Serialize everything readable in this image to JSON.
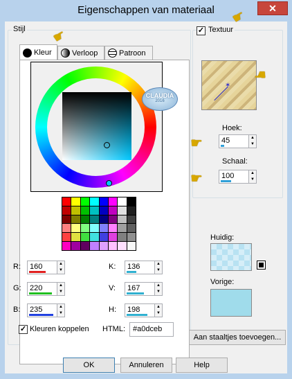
{
  "window": {
    "title": "Eigenschappen van materiaal",
    "close_glyph": "✕"
  },
  "style_group": {
    "label": "Stijl"
  },
  "tabs": [
    {
      "label": "Kleur",
      "icon": "filled-circle-icon"
    },
    {
      "label": "Verloop",
      "icon": "gradient-circle-icon"
    },
    {
      "label": "Patroon",
      "icon": "globe-icon"
    }
  ],
  "color_inputs": [
    {
      "key": "R",
      "label": "R:",
      "value": "160",
      "bar_color": "#e02020",
      "fraction": 0.63
    },
    {
      "key": "G",
      "label": "G:",
      "value": "220",
      "bar_color": "#20c020",
      "fraction": 0.86
    },
    {
      "key": "B",
      "label": "B:",
      "value": "235",
      "bar_color": "#2040e0",
      "fraction": 0.92
    },
    {
      "key": "K",
      "label": "K:",
      "value": "136",
      "bar_color": "#30b0d0",
      "fraction": 0.38
    },
    {
      "key": "V",
      "label": "V:",
      "value": "167",
      "bar_color": "#30b0d0",
      "fraction": 0.65
    },
    {
      "key": "H",
      "label": "H:",
      "value": "198",
      "bar_color": "#30b0d0",
      "fraction": 0.78
    }
  ],
  "link_colors": {
    "label": "Kleuren koppelen",
    "checked": true
  },
  "html_field": {
    "label": "HTML:",
    "value": "#a0dceb"
  },
  "texture": {
    "label": "Textuur",
    "checked": true,
    "angle_label": "Hoek:",
    "angle_value": "45",
    "angle_fraction": 0.12,
    "scale_label": "Schaal:",
    "scale_value": "100",
    "scale_fraction": 0.4
  },
  "current": {
    "label": "Huidig:"
  },
  "previous": {
    "label": "Vorige:"
  },
  "add_swatches_button": "Aan staaltjes toevoegen...",
  "buttons": {
    "ok": "OK",
    "cancel": "Annuleren",
    "help": "Help"
  },
  "watermark": {
    "text": "CLAUDIA",
    "subtext": "2016"
  },
  "colors": {
    "selected": "#a0dceb",
    "current_bg": "#b8e2f2"
  },
  "swatches": [
    "#ff0000",
    "#ffff00",
    "#00ff00",
    "#00ffff",
    "#0000ff",
    "#ff00ff",
    "#ffffff",
    "#000000",
    "#c00000",
    "#c0c000",
    "#00c000",
    "#00c0c0",
    "#0000c0",
    "#c000c0",
    "#e0e0e0",
    "#202020",
    "#800000",
    "#808000",
    "#008000",
    "#008080",
    "#000080",
    "#800080",
    "#c0c0c0",
    "#404040",
    "#ff8080",
    "#ffff80",
    "#80ff80",
    "#80ffff",
    "#8080ff",
    "#ff80ff",
    "#a0a0a0",
    "#606060",
    "#ff4040",
    "#e0e040",
    "#40e040",
    "#40e0e0",
    "#4040e0",
    "#e040e0",
    "#808080",
    "#909090",
    "#ff00c0",
    "#a000a0",
    "#600060",
    "#c080ff",
    "#e0a0ff",
    "#ffc0ff",
    "#ffe0ff",
    "#f8f8f8"
  ]
}
